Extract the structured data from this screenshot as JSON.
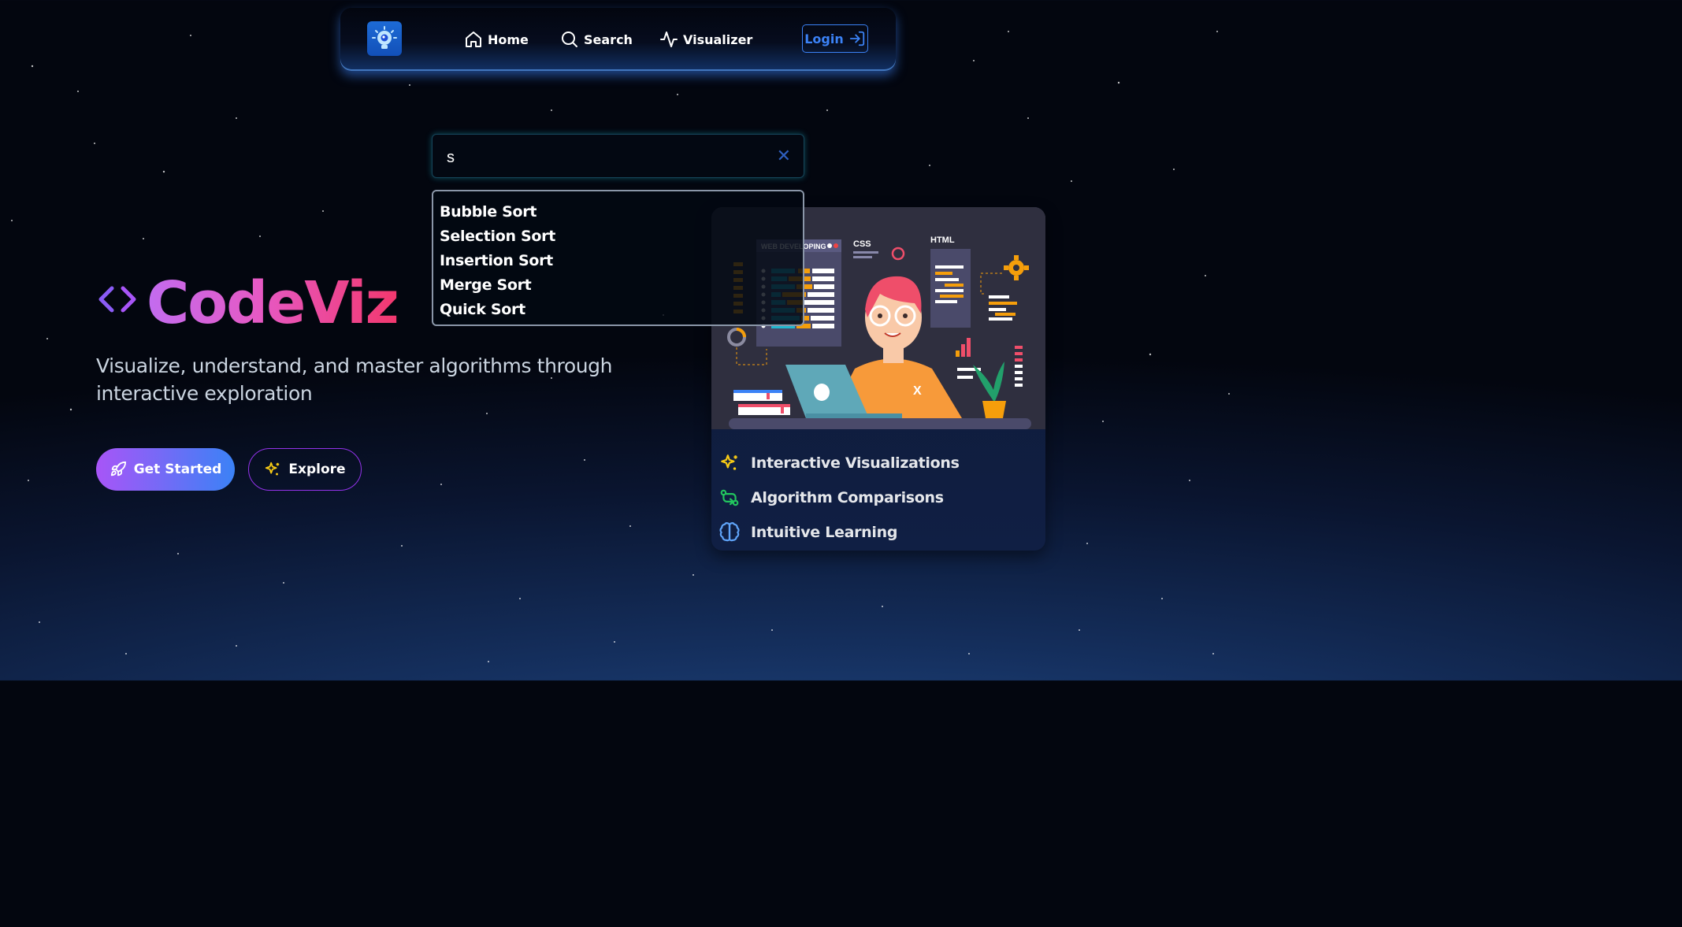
{
  "nav": {
    "items": [
      {
        "label": "Home",
        "icon": "home-icon"
      },
      {
        "label": "Search",
        "icon": "search-icon"
      },
      {
        "label": "Visualizer",
        "icon": "activity-icon"
      }
    ],
    "login_label": "Login",
    "logo_icon": "lightbulb-icon"
  },
  "search": {
    "value": "s",
    "clear_icon": "close-icon",
    "results": [
      "Bubble Sort",
      "Selection Sort",
      "Insertion Sort",
      "Merge Sort",
      "Quick Sort"
    ]
  },
  "hero": {
    "title": "CodeViz",
    "icon": "code-icon",
    "subtitle": "Visualize, understand, and master algorithms through interactive exploration",
    "primary_button": "Get Started",
    "secondary_button": "Explore"
  },
  "card": {
    "illustration_labels": {
      "panel_title": "WEB DEVELOPING",
      "css": "CSS",
      "html": "HTML"
    },
    "features": [
      {
        "label": "Interactive Visualizations",
        "icon": "sparkles-icon",
        "color": "#facc15"
      },
      {
        "label": "Algorithm Comparisons",
        "icon": "git-compare-icon",
        "color": "#22c55e"
      },
      {
        "label": "Intuitive Learning",
        "icon": "brain-icon",
        "color": "#60a5fa"
      }
    ]
  },
  "colors": {
    "accent_blue": "#3b82f6",
    "accent_purple": "#a855f7",
    "title_gradient_start": "#c26cf0",
    "title_gradient_end": "#f2386e"
  }
}
